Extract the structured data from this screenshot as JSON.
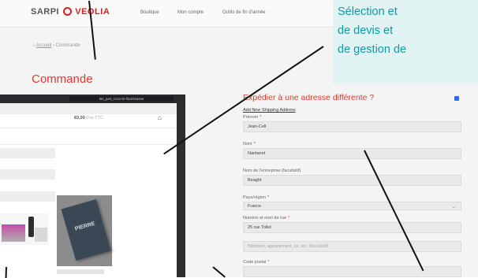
{
  "header": {
    "logo_part1": "SARPI",
    "logo_part2": "VEOLIA",
    "nav": [
      "Boutique",
      "Mon compte",
      "Outils de fin d'année"
    ]
  },
  "breadcrumb": {
    "home": "Accueil",
    "sep": " › ",
    "current": "Commande"
  },
  "page_title": "Commande",
  "shipping": {
    "title": "Expédier à une adresse différente ?",
    "checkbox_checked": true,
    "add_link": "Add New Shipping Address",
    "fields": [
      {
        "label": "Prénom",
        "required": true,
        "value": "Jean-Cell",
        "type": "text"
      },
      {
        "label": "Nom",
        "required": true,
        "value": "Nantanet",
        "type": "text"
      },
      {
        "label": "Nom de l'entreprise (facultatif)",
        "required": false,
        "value": "Beaght",
        "type": "text"
      },
      {
        "label": "Pays/région",
        "required": true,
        "value": "France",
        "type": "select"
      },
      {
        "label": "Numéro et nom de rue",
        "required": true,
        "value": "25 rue Tollet",
        "type": "text"
      },
      {
        "label": "",
        "required": false,
        "value": "Bâtiment, appartement, lot, etc. (facultatif)",
        "type": "placeholder"
      },
      {
        "label": "Code postal",
        "required": true,
        "value": "",
        "type": "text"
      }
    ]
  },
  "overlay_text": {
    "lines": [
      "Sélection et",
      "de devis et",
      "de gestion de"
    ]
  },
  "laptop": {
    "bar_text": "Bo_just_ccun-bi-final-laosse",
    "price": "€0,00",
    "price_suffix": "Prix TTC",
    "book_title": "PIERRE"
  },
  "colors": {
    "accent_red": "#e03a2a",
    "overlay_bg": "#e2f3f4",
    "overlay_text": "#0b9ca7",
    "checkbox_blue": "#2f6be5"
  }
}
